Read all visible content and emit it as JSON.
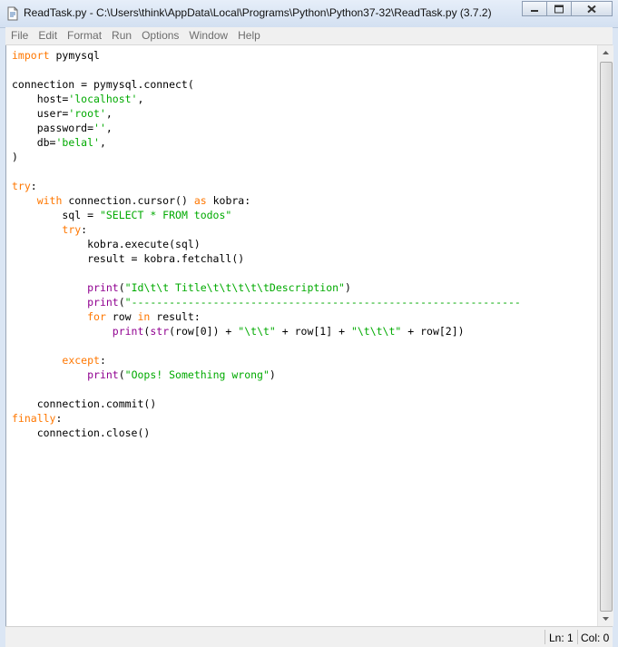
{
  "window": {
    "title": "ReadTask.py - C:\\Users\\think\\AppData\\Local\\Programs\\Python\\Python37-32\\ReadTask.py (3.7.2)"
  },
  "menu": [
    "File",
    "Edit",
    "Format",
    "Run",
    "Options",
    "Window",
    "Help"
  ],
  "code": [
    [
      {
        "t": "import",
        "c": "kw"
      },
      {
        "t": " pymysql",
        "c": ""
      }
    ],
    [],
    [
      {
        "t": "connection = pymysql.connect(",
        "c": ""
      }
    ],
    [
      {
        "t": "    host=",
        "c": ""
      },
      {
        "t": "'localhost'",
        "c": "str"
      },
      {
        "t": ",",
        "c": ""
      }
    ],
    [
      {
        "t": "    user=",
        "c": ""
      },
      {
        "t": "'root'",
        "c": "str"
      },
      {
        "t": ",",
        "c": ""
      }
    ],
    [
      {
        "t": "    password=",
        "c": ""
      },
      {
        "t": "''",
        "c": "str"
      },
      {
        "t": ",",
        "c": ""
      }
    ],
    [
      {
        "t": "    db=",
        "c": ""
      },
      {
        "t": "'belal'",
        "c": "str"
      },
      {
        "t": ",",
        "c": ""
      }
    ],
    [
      {
        "t": ")",
        "c": ""
      }
    ],
    [],
    [
      {
        "t": "try",
        "c": "kw"
      },
      {
        "t": ":",
        "c": ""
      }
    ],
    [
      {
        "t": "    ",
        "c": ""
      },
      {
        "t": "with",
        "c": "kw"
      },
      {
        "t": " connection.cursor() ",
        "c": ""
      },
      {
        "t": "as",
        "c": "kw"
      },
      {
        "t": " kobra:",
        "c": ""
      }
    ],
    [
      {
        "t": "        sql = ",
        "c": ""
      },
      {
        "t": "\"SELECT * FROM todos\"",
        "c": "str"
      }
    ],
    [
      {
        "t": "        ",
        "c": ""
      },
      {
        "t": "try",
        "c": "kw"
      },
      {
        "t": ":",
        "c": ""
      }
    ],
    [
      {
        "t": "            kobra.execute(sql)",
        "c": ""
      }
    ],
    [
      {
        "t": "            result = kobra.fetchall()",
        "c": ""
      }
    ],
    [],
    [
      {
        "t": "            ",
        "c": ""
      },
      {
        "t": "print",
        "c": "bi"
      },
      {
        "t": "(",
        "c": ""
      },
      {
        "t": "\"Id\\t\\t Title\\t\\t\\t\\t\\tDescription\"",
        "c": "str"
      },
      {
        "t": ")",
        "c": ""
      }
    ],
    [
      {
        "t": "            ",
        "c": ""
      },
      {
        "t": "print",
        "c": "bi"
      },
      {
        "t": "(",
        "c": ""
      },
      {
        "t": "\"--------------------------------------------------------------",
        "c": "str"
      }
    ],
    [
      {
        "t": "            ",
        "c": ""
      },
      {
        "t": "for",
        "c": "kw"
      },
      {
        "t": " row ",
        "c": ""
      },
      {
        "t": "in",
        "c": "kw"
      },
      {
        "t": " result:",
        "c": ""
      }
    ],
    [
      {
        "t": "                ",
        "c": ""
      },
      {
        "t": "print",
        "c": "bi"
      },
      {
        "t": "(",
        "c": ""
      },
      {
        "t": "str",
        "c": "bi"
      },
      {
        "t": "(row[0]) + ",
        "c": ""
      },
      {
        "t": "\"\\t\\t\"",
        "c": "str"
      },
      {
        "t": " + row[1] + ",
        "c": ""
      },
      {
        "t": "\"\\t\\t\\t\"",
        "c": "str"
      },
      {
        "t": " + row[2])",
        "c": ""
      }
    ],
    [],
    [
      {
        "t": "        ",
        "c": ""
      },
      {
        "t": "except",
        "c": "kw"
      },
      {
        "t": ":",
        "c": ""
      }
    ],
    [
      {
        "t": "            ",
        "c": ""
      },
      {
        "t": "print",
        "c": "bi"
      },
      {
        "t": "(",
        "c": ""
      },
      {
        "t": "\"Oops! Something wrong\"",
        "c": "str"
      },
      {
        "t": ")",
        "c": ""
      }
    ],
    [],
    [
      {
        "t": "    connection.commit()",
        "c": ""
      }
    ],
    [
      {
        "t": "finally",
        "c": "kw"
      },
      {
        "t": ":",
        "c": ""
      }
    ],
    [
      {
        "t": "    connection.close()",
        "c": ""
      }
    ]
  ],
  "status": {
    "line": "Ln: 1",
    "col": "Col: 0"
  },
  "colors": {
    "keyword": "#ff7700",
    "string": "#00aa00",
    "builtin": "#900090"
  }
}
